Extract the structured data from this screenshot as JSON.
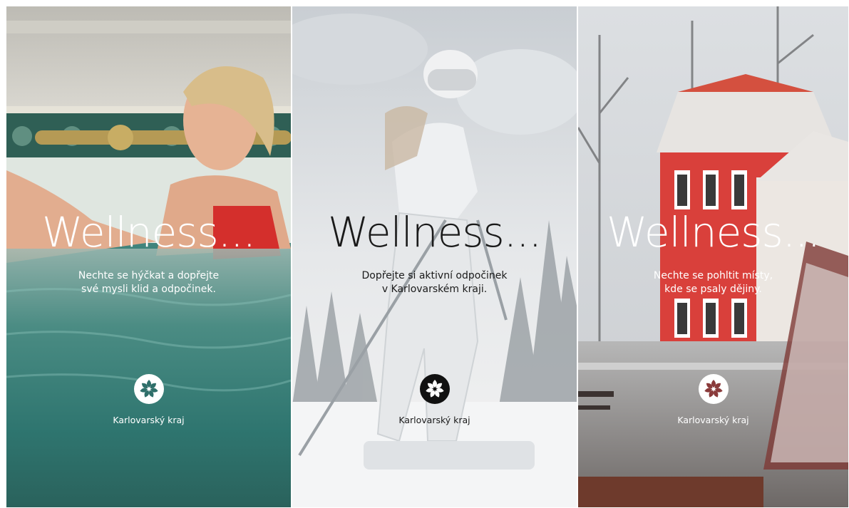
{
  "panels": [
    {
      "headline": "Wellness...",
      "subtitle_lines": [
        "Nechte se hýčkat a dopřejte",
        "své mysli klid a odpočinek."
      ],
      "brand": "Karlovarský kraj",
      "logo_icon": "karlovarsky-kraj-flower-icon",
      "text_color": "#ffffff",
      "logo_bg": "#ffffff",
      "logo_fg": "#2f6f6a"
    },
    {
      "headline": "Wellness...",
      "subtitle_lines": [
        "Dopřejte si aktivní odpočinek",
        "v Karlovarském kraji."
      ],
      "brand": "Karlovarský kraj",
      "logo_icon": "karlovarsky-kraj-flower-icon",
      "text_color": "#1a1a1a",
      "logo_bg": "#111111",
      "logo_fg": "#ffffff"
    },
    {
      "headline": "Wellness...",
      "subtitle_lines": [
        "Nechte se pohltit místy,",
        "kde se psaly dějiny."
      ],
      "brand": "Karlovarský kraj",
      "logo_icon": "karlovarsky-kraj-flower-icon",
      "text_color": "#ffffff",
      "logo_bg": "#ffffff",
      "logo_fg": "#8a3a3a"
    }
  ]
}
